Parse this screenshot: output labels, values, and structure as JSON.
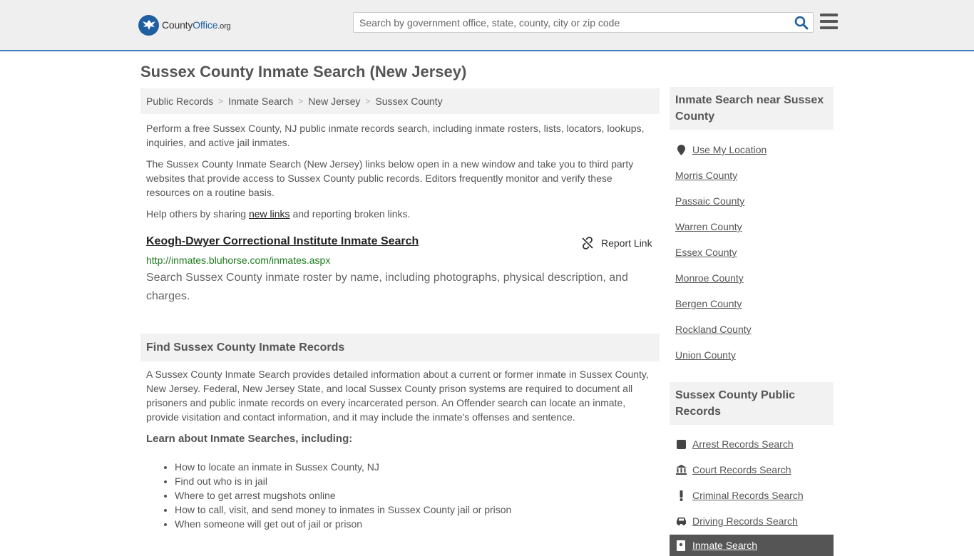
{
  "header": {
    "logo_brand_a": "County",
    "logo_brand_b": "Office",
    "logo_tld": ".org",
    "search_placeholder": "Search by government office, state, county, city or zip code",
    "search_icon": "search-icon",
    "menu_icon": "hamburger-menu-icon",
    "accent_color": "#3a7fbf"
  },
  "page": {
    "title": "Sussex County Inmate Search (New Jersey)"
  },
  "breadcrumb": [
    {
      "label": "Public Records"
    },
    {
      "label": "Inmate Search"
    },
    {
      "label": "New Jersey"
    },
    {
      "label": "Sussex County"
    }
  ],
  "intro": {
    "p1": "Perform a free Sussex County, NJ public inmate records search, including inmate rosters, lists, locators, lookups, inquiries, and active jail inmates.",
    "p2": "The Sussex County Inmate Search (New Jersey) links below open in a new window and take you to third party websites that provide access to Sussex County public records. Editors frequently monitor and verify these resources on a routine basis.",
    "p3_before": "Help others by sharing ",
    "p3_link": "new links",
    "p3_after": " and reporting broken links."
  },
  "result": {
    "title": "Keogh-Dwyer Correctional Institute Inmate Search",
    "report_label": "Report Link",
    "url": "http://inmates.bluhorse.com/inmates.aspx",
    "description": "Search Sussex County inmate roster by name, including photographs, physical description, and charges."
  },
  "records_section": {
    "heading": "Find Sussex County Inmate Records",
    "body": "A Sussex County Inmate Search provides detailed information about a current or former inmate in Sussex County, New Jersey. Federal, New Jersey State, and local Sussex County prison systems are required to document all prisoners and public inmate records on every incarcerated person. An Offender search can locate an inmate, provide visitation and contact information, and it may include the inmate's offenses and sentence.",
    "learn_heading": "Learn about Inmate Searches, including:",
    "bullets": [
      "How to locate an inmate in Sussex County, NJ",
      "Find out who is in jail",
      "Where to get arrest mugshots online",
      "How to call, visit, and send money to inmates in Sussex County jail or prison",
      "When someone will get out of jail or prison"
    ]
  },
  "sidebar": {
    "nearby_heading": "Inmate Search near Sussex County",
    "use_location": "Use My Location",
    "nearby": [
      "Morris County",
      "Passaic County",
      "Warren County",
      "Essex County",
      "Monroe County",
      "Bergen County",
      "Rockland County",
      "Union County"
    ],
    "records_heading": "Sussex County Public Records",
    "records": [
      {
        "label": "Arrest Records Search",
        "icon": "square-icon"
      },
      {
        "label": "Court Records Search",
        "icon": "courthouse-icon"
      },
      {
        "label": "Criminal Records Search",
        "icon": "exclamation-icon"
      },
      {
        "label": "Driving Records Search",
        "icon": "car-icon"
      },
      {
        "label": "Inmate Search",
        "icon": "id-badge-icon"
      }
    ]
  }
}
